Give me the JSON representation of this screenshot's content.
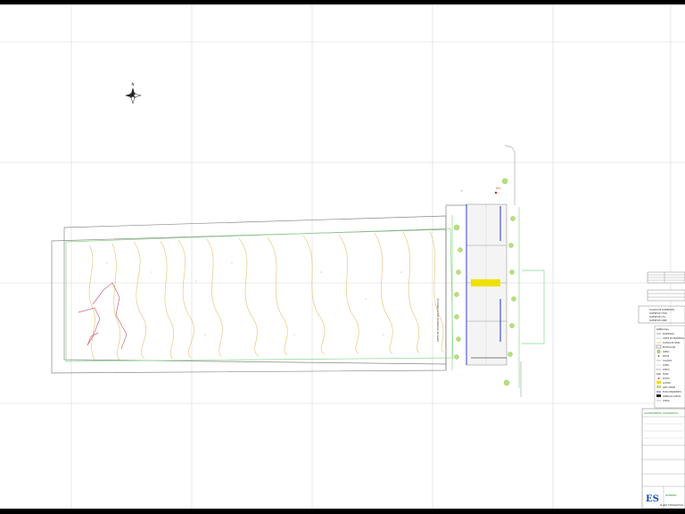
{
  "compass": {
    "north_label": "N"
  },
  "plot": {
    "point_label": "P3.1",
    "access_label": "Y",
    "side_annotation": "LIMITE DE PROPIEDAD SEGUN MEDICION"
  },
  "legend": {
    "table_title": "CUADRO DE SUPERFICIES",
    "table_rows": [
      "SUPERFICIE TOTAL",
      "SUPERFICIE UTIL",
      "SUPERFICIE LIBRE"
    ],
    "header": "SIMBOLOGIA",
    "items": [
      "PROPIEDAD",
      "LIMITE DE PROPIEDAD",
      "CURVAS DE NIVEL",
      "EDIFICACION",
      "ARBOL",
      "POSTE",
      "CALZADA",
      "ACERA",
      "CERCO",
      "MURO",
      "PUNTO",
      "ACCESO",
      "AREA VERDE",
      "ESTACIONAMIENTO",
      "SIMBOLOS VARIOS",
      "OTROS"
    ]
  },
  "title_block": {
    "header": "LEVANTAMIENTO TOPOGRAFICO",
    "logo": "ES",
    "logo_sub": "INGENIERIA",
    "footer": "PLANO TOPOGRAFICO"
  },
  "colors": {
    "contour": "#e6c070",
    "boundary": "#8ad98a",
    "outline": "#888888",
    "grid": "#d8d8d8",
    "slope": "#cc6677",
    "highlight": "#f0e000",
    "structure": "#2233cc"
  }
}
